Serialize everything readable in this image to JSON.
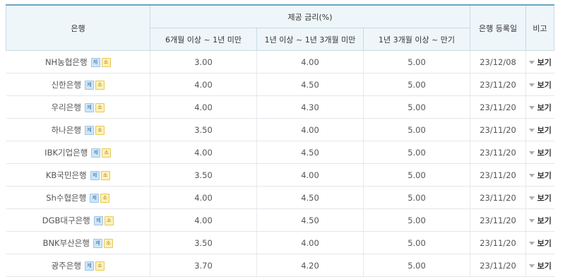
{
  "header": {
    "bank": "은행",
    "rate_group": "제공 금리(%)",
    "period1": "6개월 이상 ~ 1년 미만",
    "period2": "1년 이상 ~ 1년 3개월 미만",
    "period3": "1년 3개월 이상 ~ 만기",
    "reg_date": "은행 등록일",
    "note": "비고"
  },
  "badges": {
    "blue": "제",
    "yellow": "소"
  },
  "view_label": "보기",
  "rows": [
    {
      "bank": "NH농협은행",
      "r1": "3.00",
      "r2": "4.00",
      "r3": "5.00",
      "date": "23/12/08"
    },
    {
      "bank": "신한은행",
      "r1": "4.00",
      "r2": "4.50",
      "r3": "5.00",
      "date": "23/11/20"
    },
    {
      "bank": "우리은행",
      "r1": "4.00",
      "r2": "4.30",
      "r3": "5.00",
      "date": "23/11/20"
    },
    {
      "bank": "하나은행",
      "r1": "3.50",
      "r2": "4.00",
      "r3": "5.00",
      "date": "23/11/20"
    },
    {
      "bank": "IBK기업은행",
      "r1": "4.00",
      "r2": "4.50",
      "r3": "5.00",
      "date": "23/11/20"
    },
    {
      "bank": "KB국민은행",
      "r1": "3.50",
      "r2": "4.00",
      "r3": "5.00",
      "date": "23/11/20"
    },
    {
      "bank": "Sh수협은행",
      "r1": "4.00",
      "r2": "4.50",
      "r3": "5.00",
      "date": "23/11/20"
    },
    {
      "bank": "DGB대구은행",
      "r1": "4.00",
      "r2": "4.50",
      "r3": "5.00",
      "date": "23/11/20"
    },
    {
      "bank": "BNK부산은행",
      "r1": "3.50",
      "r2": "4.00",
      "r3": "5.00",
      "date": "23/11/20"
    },
    {
      "bank": "광주은행",
      "r1": "3.70",
      "r2": "4.20",
      "r3": "5.00",
      "date": "23/11/20"
    }
  ]
}
